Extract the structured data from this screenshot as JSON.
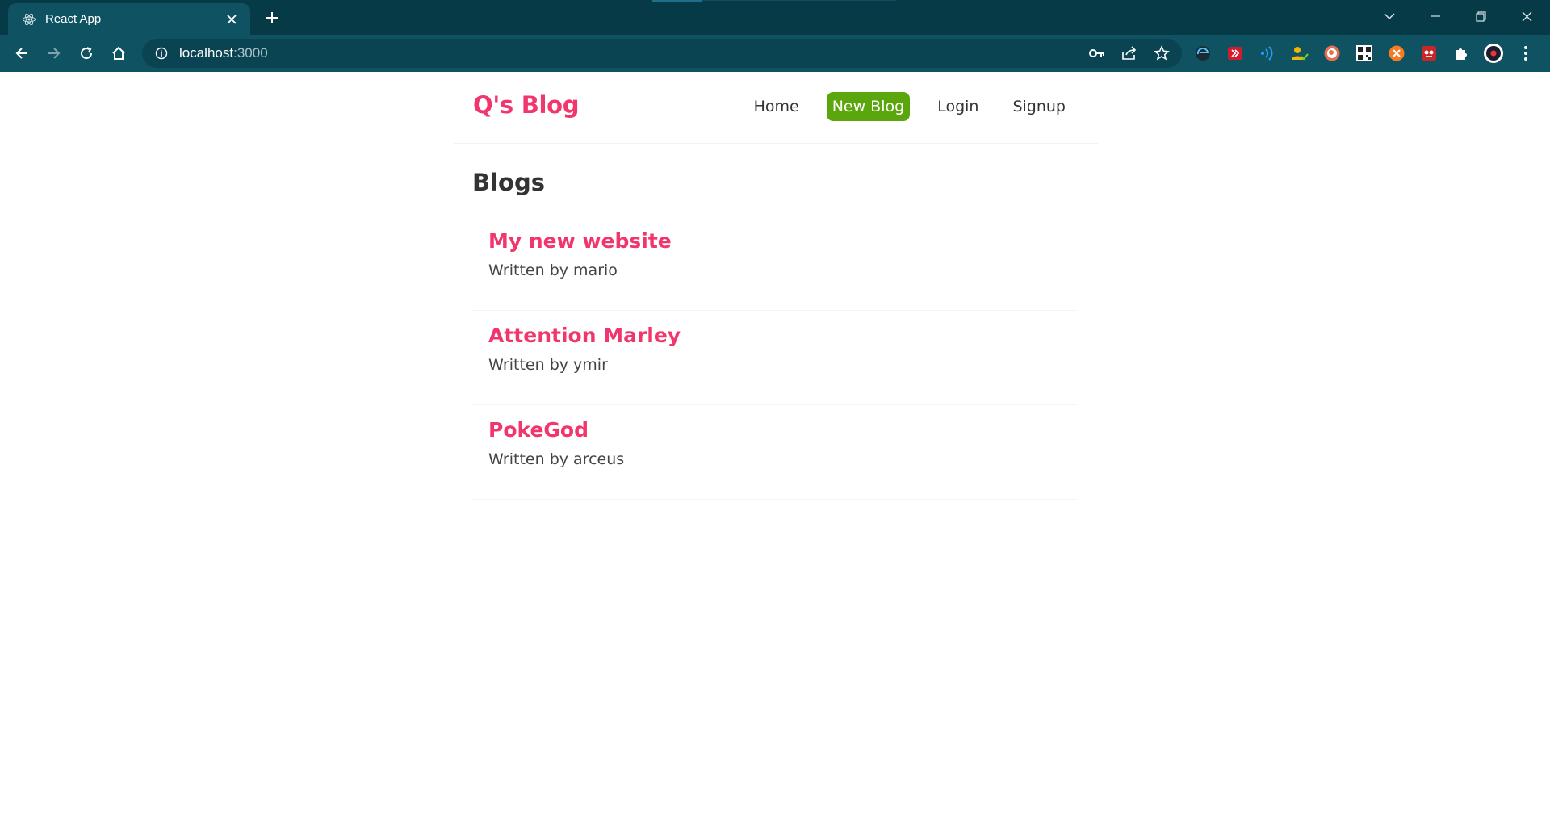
{
  "browser": {
    "tab_title": "React App",
    "url_host": "localhost",
    "url_port": ":3000"
  },
  "nav": {
    "brand": "Q's Blog",
    "links": [
      "Home",
      "New Blog",
      "Login",
      "Signup"
    ],
    "active_link": "New Blog"
  },
  "main": {
    "heading": "Blogs",
    "blogs": [
      {
        "title": "My new website",
        "author": "Written by mario"
      },
      {
        "title": "Attention Marley",
        "author": "Written by ymir"
      },
      {
        "title": "PokeGod",
        "author": "Written by arceus"
      }
    ]
  },
  "colors": {
    "brand": "#f1356d",
    "active_button": "#5aa60c",
    "chrome_dark": "#073a47",
    "chrome_toolbar": "#0f5363"
  }
}
